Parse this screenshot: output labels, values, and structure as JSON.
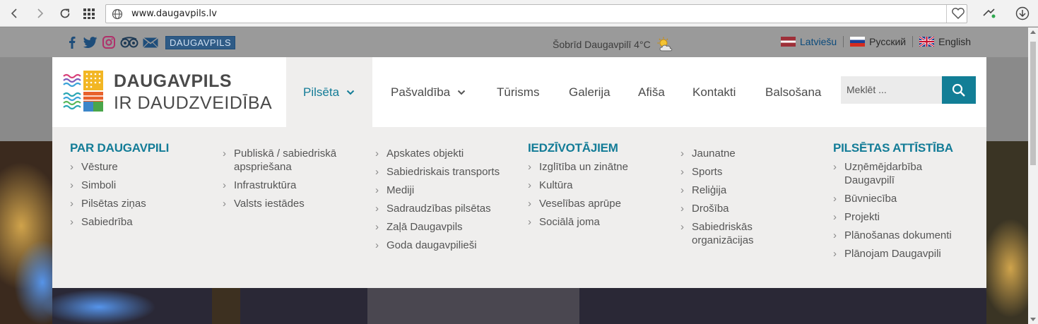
{
  "browser": {
    "url": "www.daugavpils.lv"
  },
  "topbar": {
    "social": [
      "facebook-icon",
      "twitter-icon",
      "instagram-icon",
      "tripadvisor-icon",
      "mail-icon"
    ],
    "badge": "DAUGAVPILS",
    "weather": "Šobrīd Daugavpilī 4°C",
    "languages": [
      {
        "label": "Latviešu",
        "flag": "latvia-flag-icon"
      },
      {
        "label": "Русский",
        "flag": "russia-flag-icon"
      },
      {
        "label": "English",
        "flag": "uk-flag-icon"
      }
    ]
  },
  "header": {
    "brand_line1": "DAUGAVPILS",
    "brand_line2": "IR DAUDZVEIDĪBA",
    "menu": [
      "Pilsēta",
      "Pašvaldība",
      "Tūrisms",
      "Galerija",
      "Afiša",
      "Kontakti",
      "Balsošana"
    ],
    "search_placeholder": "Meklēt ..."
  },
  "mega_menu": {
    "col1": {
      "title": "PAR DAUGAVPILI",
      "items": [
        "Vēsture",
        "Simboli",
        "Pilsētas ziņas",
        "Sabiedrība"
      ]
    },
    "col2": {
      "items": [
        "Publiskā / sabiedriskā apspriešana",
        "Infrastruktūra",
        "Valsts iestādes"
      ]
    },
    "col3": {
      "items": [
        "Apskates objekti",
        "Sabiedriskais transports",
        "Mediji",
        "Sadraudzības pilsētas",
        "Zaļā Daugavpils",
        "Goda daugavpilieši"
      ]
    },
    "col4": {
      "title": "IEDZĪVOTĀJIEM",
      "items": [
        "Izglītība un zinātne",
        "Kultūra",
        "Veselības aprūpe",
        "Sociālā joma"
      ]
    },
    "col5": {
      "items": [
        "Jaunatne",
        "Sports",
        "Reliģija",
        "Drošība",
        "Sabiedriskās organizācijas"
      ]
    },
    "col6": {
      "title": "PILSĒTAS ATTĪSTĪBA",
      "items": [
        "Uzņēmējdarbība Daugavpilī",
        "Būvniecība",
        "Projekti",
        "Plānošanas dokumenti",
        "Plānojam Daugavpili"
      ]
    }
  },
  "colors": {
    "accent": "#137c97",
    "search_button": "#127e96",
    "menu_bg": "#efeeed"
  }
}
